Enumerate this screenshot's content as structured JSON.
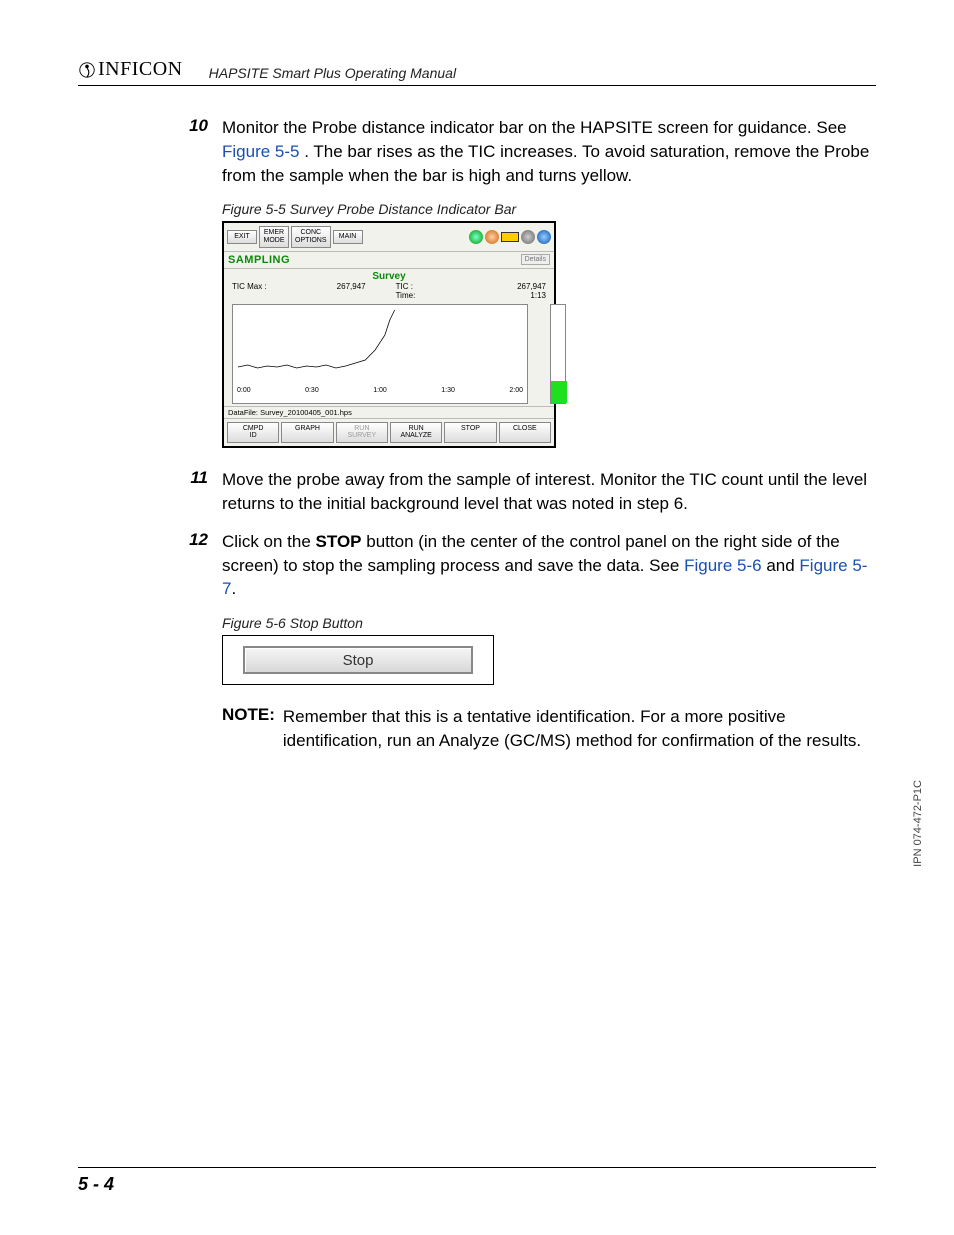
{
  "header": {
    "logo_text": "INFICON",
    "manual_title": "HAPSITE Smart Plus Operating Manual"
  },
  "steps": [
    {
      "num": "10",
      "text_pre": "Monitor the Probe distance indicator bar on the HAPSITE screen for guidance. See ",
      "link": "Figure 5-5",
      "text_post": ". The bar rises as the TIC increases. To avoid saturation, remove the Probe from the sample when the bar is high and turns yellow."
    },
    {
      "num": "11",
      "text_pre": "Move the probe away from the sample of interest. Monitor the TIC count until the level returns to the initial background level that was noted in step 6.",
      "link": "",
      "text_post": ""
    },
    {
      "num": "12",
      "text_pre": "Click on the ",
      "bold": "STOP",
      "text_mid": " button (in the center of the control panel on the right side of the screen) to stop the sampling process and save the data. See ",
      "link1": "Figure 5-6",
      "text_and": " and ",
      "link2": "Figure 5-7",
      "text_end": "."
    }
  ],
  "figure55": {
    "caption": "Figure 5-5  Survey Probe Distance Indicator Bar",
    "topbar": {
      "exit": "EXIT",
      "emer": "EMER\nMODE",
      "conc": "CONC\nOPTIONS",
      "main": "MAIN"
    },
    "sampling_label": "SAMPLING",
    "details": "Details",
    "survey_title": "Survey",
    "tic_max_label": "TIC Max :",
    "tic_max_value": "267,947",
    "tic_label": "TIC :",
    "tic_value": "267,947",
    "time_label": "Time:",
    "time_value": "1:13",
    "x_ticks": [
      "0:00",
      "0:30",
      "1:00",
      "1:30",
      "2:00"
    ],
    "datafile": "DataFile: Survey_20100405_001.hps",
    "bottom": {
      "cmpd": "CMPD\nID",
      "graph": "GRAPH",
      "run_survey": "RUN\nSURVEY",
      "run_analyze": "RUN\nANALYZE",
      "stop": "STOP",
      "close": "CLOSE"
    }
  },
  "figure56": {
    "caption": "Figure 5-6  Stop Button",
    "button_label": "Stop"
  },
  "note": {
    "label": "NOTE:",
    "text": "Remember that this is a tentative identification. For a more positive identification, run an Analyze (GC/MS) method for confirmation of the results."
  },
  "side_ipn": "IPN 074-472-P1C",
  "page_num": "5 - 4",
  "chart_data": {
    "type": "line",
    "title": "Survey",
    "xlabel": "Time",
    "ylabel": "TIC",
    "x_range": [
      "0:00",
      "2:00"
    ],
    "x_ticks": [
      "0:00",
      "0:30",
      "1:00",
      "1:30",
      "2:00"
    ],
    "series": [
      {
        "name": "TIC",
        "x": [
          "0:00",
          "0:05",
          "0:10",
          "0:15",
          "0:20",
          "0:25",
          "0:30",
          "0:35",
          "0:40",
          "0:45",
          "0:50",
          "0:55",
          "1:00",
          "1:05",
          "1:10",
          "1:13"
        ],
        "y": [
          20000,
          22000,
          21000,
          23000,
          20000,
          22000,
          21000,
          23000,
          20000,
          22000,
          21000,
          50000,
          120000,
          200000,
          260000,
          267947
        ]
      }
    ],
    "tic_max": 267947,
    "current_tic": 267947,
    "current_time": "1:13"
  }
}
